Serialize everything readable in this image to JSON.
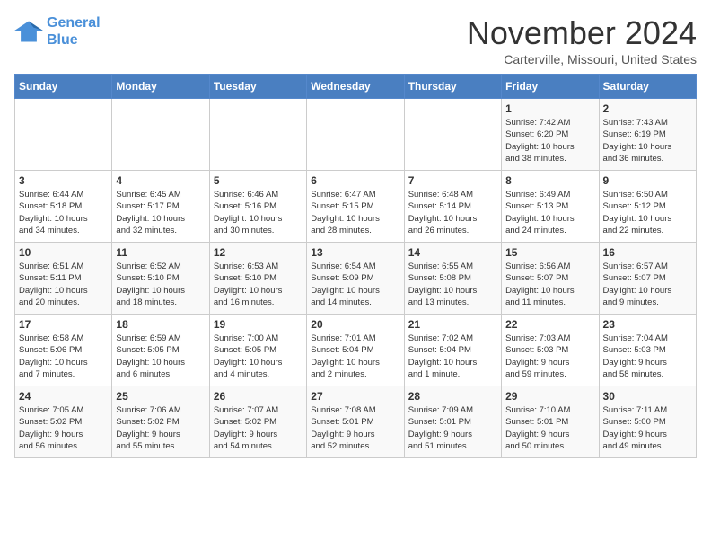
{
  "logo": {
    "line1": "General",
    "line2": "Blue"
  },
  "title": "November 2024",
  "subtitle": "Carterville, Missouri, United States",
  "days_of_week": [
    "Sunday",
    "Monday",
    "Tuesday",
    "Wednesday",
    "Thursday",
    "Friday",
    "Saturday"
  ],
  "weeks": [
    [
      {
        "day": "",
        "info": ""
      },
      {
        "day": "",
        "info": ""
      },
      {
        "day": "",
        "info": ""
      },
      {
        "day": "",
        "info": ""
      },
      {
        "day": "",
        "info": ""
      },
      {
        "day": "1",
        "info": "Sunrise: 7:42 AM\nSunset: 6:20 PM\nDaylight: 10 hours\nand 38 minutes."
      },
      {
        "day": "2",
        "info": "Sunrise: 7:43 AM\nSunset: 6:19 PM\nDaylight: 10 hours\nand 36 minutes."
      }
    ],
    [
      {
        "day": "3",
        "info": "Sunrise: 6:44 AM\nSunset: 5:18 PM\nDaylight: 10 hours\nand 34 minutes."
      },
      {
        "day": "4",
        "info": "Sunrise: 6:45 AM\nSunset: 5:17 PM\nDaylight: 10 hours\nand 32 minutes."
      },
      {
        "day": "5",
        "info": "Sunrise: 6:46 AM\nSunset: 5:16 PM\nDaylight: 10 hours\nand 30 minutes."
      },
      {
        "day": "6",
        "info": "Sunrise: 6:47 AM\nSunset: 5:15 PM\nDaylight: 10 hours\nand 28 minutes."
      },
      {
        "day": "7",
        "info": "Sunrise: 6:48 AM\nSunset: 5:14 PM\nDaylight: 10 hours\nand 26 minutes."
      },
      {
        "day": "8",
        "info": "Sunrise: 6:49 AM\nSunset: 5:13 PM\nDaylight: 10 hours\nand 24 minutes."
      },
      {
        "day": "9",
        "info": "Sunrise: 6:50 AM\nSunset: 5:12 PM\nDaylight: 10 hours\nand 22 minutes."
      }
    ],
    [
      {
        "day": "10",
        "info": "Sunrise: 6:51 AM\nSunset: 5:11 PM\nDaylight: 10 hours\nand 20 minutes."
      },
      {
        "day": "11",
        "info": "Sunrise: 6:52 AM\nSunset: 5:10 PM\nDaylight: 10 hours\nand 18 minutes."
      },
      {
        "day": "12",
        "info": "Sunrise: 6:53 AM\nSunset: 5:10 PM\nDaylight: 10 hours\nand 16 minutes."
      },
      {
        "day": "13",
        "info": "Sunrise: 6:54 AM\nSunset: 5:09 PM\nDaylight: 10 hours\nand 14 minutes."
      },
      {
        "day": "14",
        "info": "Sunrise: 6:55 AM\nSunset: 5:08 PM\nDaylight: 10 hours\nand 13 minutes."
      },
      {
        "day": "15",
        "info": "Sunrise: 6:56 AM\nSunset: 5:07 PM\nDaylight: 10 hours\nand 11 minutes."
      },
      {
        "day": "16",
        "info": "Sunrise: 6:57 AM\nSunset: 5:07 PM\nDaylight: 10 hours\nand 9 minutes."
      }
    ],
    [
      {
        "day": "17",
        "info": "Sunrise: 6:58 AM\nSunset: 5:06 PM\nDaylight: 10 hours\nand 7 minutes."
      },
      {
        "day": "18",
        "info": "Sunrise: 6:59 AM\nSunset: 5:05 PM\nDaylight: 10 hours\nand 6 minutes."
      },
      {
        "day": "19",
        "info": "Sunrise: 7:00 AM\nSunset: 5:05 PM\nDaylight: 10 hours\nand 4 minutes."
      },
      {
        "day": "20",
        "info": "Sunrise: 7:01 AM\nSunset: 5:04 PM\nDaylight: 10 hours\nand 2 minutes."
      },
      {
        "day": "21",
        "info": "Sunrise: 7:02 AM\nSunset: 5:04 PM\nDaylight: 10 hours\nand 1 minute."
      },
      {
        "day": "22",
        "info": "Sunrise: 7:03 AM\nSunset: 5:03 PM\nDaylight: 9 hours\nand 59 minutes."
      },
      {
        "day": "23",
        "info": "Sunrise: 7:04 AM\nSunset: 5:03 PM\nDaylight: 9 hours\nand 58 minutes."
      }
    ],
    [
      {
        "day": "24",
        "info": "Sunrise: 7:05 AM\nSunset: 5:02 PM\nDaylight: 9 hours\nand 56 minutes."
      },
      {
        "day": "25",
        "info": "Sunrise: 7:06 AM\nSunset: 5:02 PM\nDaylight: 9 hours\nand 55 minutes."
      },
      {
        "day": "26",
        "info": "Sunrise: 7:07 AM\nSunset: 5:02 PM\nDaylight: 9 hours\nand 54 minutes."
      },
      {
        "day": "27",
        "info": "Sunrise: 7:08 AM\nSunset: 5:01 PM\nDaylight: 9 hours\nand 52 minutes."
      },
      {
        "day": "28",
        "info": "Sunrise: 7:09 AM\nSunset: 5:01 PM\nDaylight: 9 hours\nand 51 minutes."
      },
      {
        "day": "29",
        "info": "Sunrise: 7:10 AM\nSunset: 5:01 PM\nDaylight: 9 hours\nand 50 minutes."
      },
      {
        "day": "30",
        "info": "Sunrise: 7:11 AM\nSunset: 5:00 PM\nDaylight: 9 hours\nand 49 minutes."
      }
    ]
  ]
}
